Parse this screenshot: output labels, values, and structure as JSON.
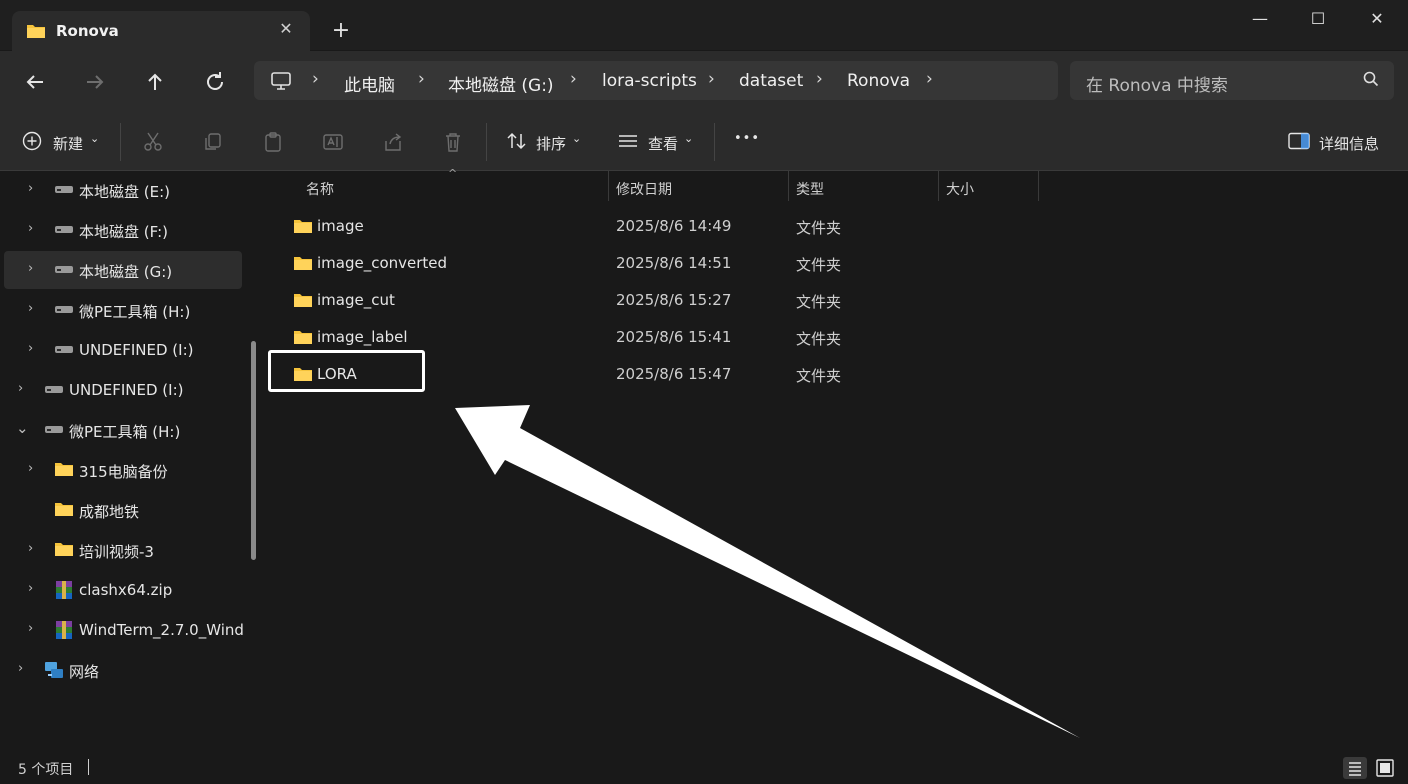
{
  "window": {
    "tab_title": "Ronova",
    "tab_close_glyph": "✕",
    "new_tab_glyph": "+",
    "minimize_glyph": "—",
    "maximize_glyph": "☐",
    "close_glyph": "✕"
  },
  "breadcrumb": [
    "此电脑",
    "本地磁盘 (G:)",
    "lora-scripts",
    "dataset",
    "Ronova"
  ],
  "search": {
    "placeholder": "在 Ronova 中搜索"
  },
  "toolbar": {
    "new_label": "新建",
    "sort_label": "排序",
    "view_label": "查看",
    "more_glyph": "•••",
    "details_label": "详细信息"
  },
  "sidebar": {
    "items": [
      {
        "label": "本地磁盘 (E:)",
        "icon": "drive-icon"
      },
      {
        "label": "本地磁盘 (F:)",
        "icon": "drive-icon"
      },
      {
        "label": "本地磁盘 (G:)",
        "icon": "drive-icon",
        "selected": true
      },
      {
        "label": "微PE工具箱 (H:)",
        "icon": "drive-icon"
      },
      {
        "label": "UNDEFINED (I:)",
        "icon": "drive-icon"
      },
      {
        "label": "UNDEFINED (I:)",
        "icon": "drive-icon"
      },
      {
        "label": "微PE工具箱 (H:)",
        "icon": "drive-icon",
        "expanded": true
      },
      {
        "label": "315电脑备份",
        "icon": "folder-icon"
      },
      {
        "label": "成都地铁",
        "icon": "folder-icon"
      },
      {
        "label": "培训视频-3",
        "icon": "folder-icon"
      },
      {
        "label": "clashx64.zip",
        "icon": "archive-icon"
      },
      {
        "label": "WindTerm_2.7.0_Wind",
        "icon": "archive-icon"
      },
      {
        "label": "网络",
        "icon": "network-icon"
      }
    ]
  },
  "columns": {
    "name": "名称",
    "modified": "修改日期",
    "type": "类型",
    "size": "大小"
  },
  "files": [
    {
      "name": "image",
      "modified": "2025/8/6 14:49",
      "type": "文件夹"
    },
    {
      "name": "image_converted",
      "modified": "2025/8/6 14:51",
      "type": "文件夹"
    },
    {
      "name": "image_cut",
      "modified": "2025/8/6 15:27",
      "type": "文件夹"
    },
    {
      "name": "image_label",
      "modified": "2025/8/6 15:41",
      "type": "文件夹"
    },
    {
      "name": "LORA",
      "modified": "2025/8/6 15:47",
      "type": "文件夹"
    }
  ],
  "status": {
    "item_count": "5 个项目"
  },
  "colors": {
    "accent_folder": "#f5c33b",
    "background": "#191919",
    "panel": "#2b2b2b"
  }
}
